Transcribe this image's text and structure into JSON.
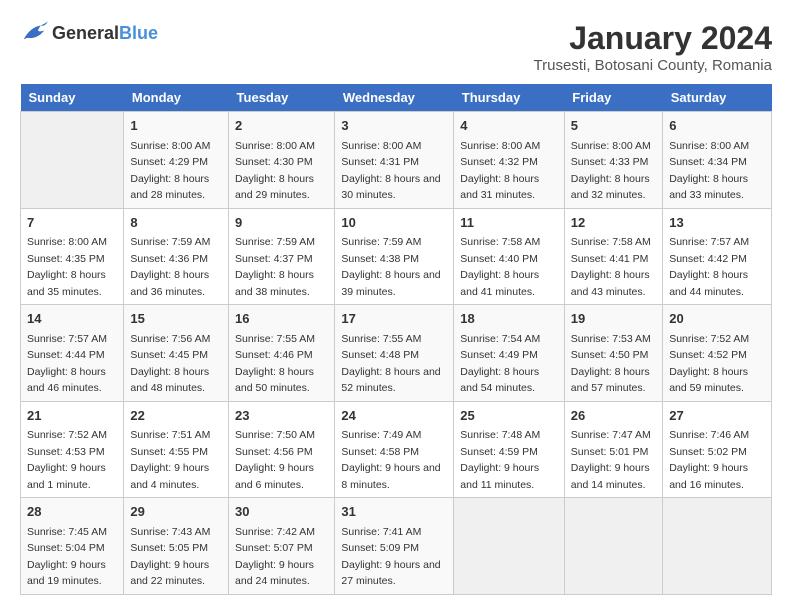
{
  "header": {
    "logo_general": "General",
    "logo_blue": "Blue",
    "title": "January 2024",
    "subtitle": "Trusesti, Botosani County, Romania"
  },
  "days_of_week": [
    "Sunday",
    "Monday",
    "Tuesday",
    "Wednesday",
    "Thursday",
    "Friday",
    "Saturday"
  ],
  "weeks": [
    [
      {
        "day": "",
        "sunrise": "",
        "sunset": "",
        "daylight": "",
        "empty": true
      },
      {
        "day": "1",
        "sunrise": "Sunrise: 8:00 AM",
        "sunset": "Sunset: 4:29 PM",
        "daylight": "Daylight: 8 hours and 28 minutes."
      },
      {
        "day": "2",
        "sunrise": "Sunrise: 8:00 AM",
        "sunset": "Sunset: 4:30 PM",
        "daylight": "Daylight: 8 hours and 29 minutes."
      },
      {
        "day": "3",
        "sunrise": "Sunrise: 8:00 AM",
        "sunset": "Sunset: 4:31 PM",
        "daylight": "Daylight: 8 hours and 30 minutes."
      },
      {
        "day": "4",
        "sunrise": "Sunrise: 8:00 AM",
        "sunset": "Sunset: 4:32 PM",
        "daylight": "Daylight: 8 hours and 31 minutes."
      },
      {
        "day": "5",
        "sunrise": "Sunrise: 8:00 AM",
        "sunset": "Sunset: 4:33 PM",
        "daylight": "Daylight: 8 hours and 32 minutes."
      },
      {
        "day": "6",
        "sunrise": "Sunrise: 8:00 AM",
        "sunset": "Sunset: 4:34 PM",
        "daylight": "Daylight: 8 hours and 33 minutes."
      }
    ],
    [
      {
        "day": "7",
        "sunrise": "Sunrise: 8:00 AM",
        "sunset": "Sunset: 4:35 PM",
        "daylight": "Daylight: 8 hours and 35 minutes."
      },
      {
        "day": "8",
        "sunrise": "Sunrise: 7:59 AM",
        "sunset": "Sunset: 4:36 PM",
        "daylight": "Daylight: 8 hours and 36 minutes."
      },
      {
        "day": "9",
        "sunrise": "Sunrise: 7:59 AM",
        "sunset": "Sunset: 4:37 PM",
        "daylight": "Daylight: 8 hours and 38 minutes."
      },
      {
        "day": "10",
        "sunrise": "Sunrise: 7:59 AM",
        "sunset": "Sunset: 4:38 PM",
        "daylight": "Daylight: 8 hours and 39 minutes."
      },
      {
        "day": "11",
        "sunrise": "Sunrise: 7:58 AM",
        "sunset": "Sunset: 4:40 PM",
        "daylight": "Daylight: 8 hours and 41 minutes."
      },
      {
        "day": "12",
        "sunrise": "Sunrise: 7:58 AM",
        "sunset": "Sunset: 4:41 PM",
        "daylight": "Daylight: 8 hours and 43 minutes."
      },
      {
        "day": "13",
        "sunrise": "Sunrise: 7:57 AM",
        "sunset": "Sunset: 4:42 PM",
        "daylight": "Daylight: 8 hours and 44 minutes."
      }
    ],
    [
      {
        "day": "14",
        "sunrise": "Sunrise: 7:57 AM",
        "sunset": "Sunset: 4:44 PM",
        "daylight": "Daylight: 8 hours and 46 minutes."
      },
      {
        "day": "15",
        "sunrise": "Sunrise: 7:56 AM",
        "sunset": "Sunset: 4:45 PM",
        "daylight": "Daylight: 8 hours and 48 minutes."
      },
      {
        "day": "16",
        "sunrise": "Sunrise: 7:55 AM",
        "sunset": "Sunset: 4:46 PM",
        "daylight": "Daylight: 8 hours and 50 minutes."
      },
      {
        "day": "17",
        "sunrise": "Sunrise: 7:55 AM",
        "sunset": "Sunset: 4:48 PM",
        "daylight": "Daylight: 8 hours and 52 minutes."
      },
      {
        "day": "18",
        "sunrise": "Sunrise: 7:54 AM",
        "sunset": "Sunset: 4:49 PM",
        "daylight": "Daylight: 8 hours and 54 minutes."
      },
      {
        "day": "19",
        "sunrise": "Sunrise: 7:53 AM",
        "sunset": "Sunset: 4:50 PM",
        "daylight": "Daylight: 8 hours and 57 minutes."
      },
      {
        "day": "20",
        "sunrise": "Sunrise: 7:52 AM",
        "sunset": "Sunset: 4:52 PM",
        "daylight": "Daylight: 8 hours and 59 minutes."
      }
    ],
    [
      {
        "day": "21",
        "sunrise": "Sunrise: 7:52 AM",
        "sunset": "Sunset: 4:53 PM",
        "daylight": "Daylight: 9 hours and 1 minute."
      },
      {
        "day": "22",
        "sunrise": "Sunrise: 7:51 AM",
        "sunset": "Sunset: 4:55 PM",
        "daylight": "Daylight: 9 hours and 4 minutes."
      },
      {
        "day": "23",
        "sunrise": "Sunrise: 7:50 AM",
        "sunset": "Sunset: 4:56 PM",
        "daylight": "Daylight: 9 hours and 6 minutes."
      },
      {
        "day": "24",
        "sunrise": "Sunrise: 7:49 AM",
        "sunset": "Sunset: 4:58 PM",
        "daylight": "Daylight: 9 hours and 8 minutes."
      },
      {
        "day": "25",
        "sunrise": "Sunrise: 7:48 AM",
        "sunset": "Sunset: 4:59 PM",
        "daylight": "Daylight: 9 hours and 11 minutes."
      },
      {
        "day": "26",
        "sunrise": "Sunrise: 7:47 AM",
        "sunset": "Sunset: 5:01 PM",
        "daylight": "Daylight: 9 hours and 14 minutes."
      },
      {
        "day": "27",
        "sunrise": "Sunrise: 7:46 AM",
        "sunset": "Sunset: 5:02 PM",
        "daylight": "Daylight: 9 hours and 16 minutes."
      }
    ],
    [
      {
        "day": "28",
        "sunrise": "Sunrise: 7:45 AM",
        "sunset": "Sunset: 5:04 PM",
        "daylight": "Daylight: 9 hours and 19 minutes."
      },
      {
        "day": "29",
        "sunrise": "Sunrise: 7:43 AM",
        "sunset": "Sunset: 5:05 PM",
        "daylight": "Daylight: 9 hours and 22 minutes."
      },
      {
        "day": "30",
        "sunrise": "Sunrise: 7:42 AM",
        "sunset": "Sunset: 5:07 PM",
        "daylight": "Daylight: 9 hours and 24 minutes."
      },
      {
        "day": "31",
        "sunrise": "Sunrise: 7:41 AM",
        "sunset": "Sunset: 5:09 PM",
        "daylight": "Daylight: 9 hours and 27 minutes."
      },
      {
        "day": "",
        "sunrise": "",
        "sunset": "",
        "daylight": "",
        "empty": true
      },
      {
        "day": "",
        "sunrise": "",
        "sunset": "",
        "daylight": "",
        "empty": true
      },
      {
        "day": "",
        "sunrise": "",
        "sunset": "",
        "daylight": "",
        "empty": true
      }
    ]
  ]
}
